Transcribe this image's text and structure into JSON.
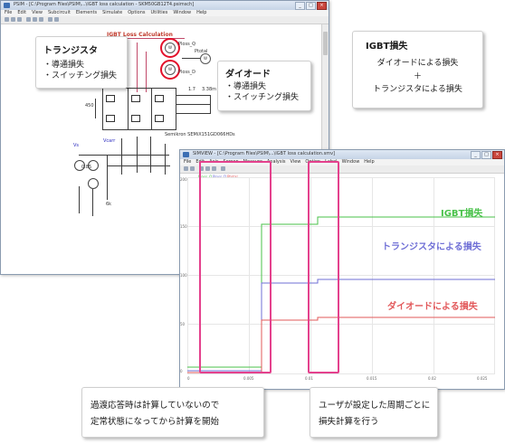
{
  "schematic_window": {
    "title": "PSIM - [C:\\Program Files\\PSIM\\...\\IGBT loss calculation - SKM50GB12T4.psimsch]",
    "menu": [
      "File",
      "Edit",
      "View",
      "Subcircuit",
      "Elements",
      "Simulate",
      "Options",
      "Utilities",
      "Window",
      "Help"
    ],
    "block_title": "IGBT Loss Calculation",
    "probe_labels": [
      "Ploss_Q",
      "Ptotal",
      "Ploss_D"
    ],
    "meter_labels": [
      "W",
      "W",
      "W"
    ],
    "component_values": [
      "1.7",
      "3.38m",
      "450",
      "0.85",
      "6k"
    ],
    "module_label": "Semikron SEMiX151GD066HDs",
    "source_labels": [
      "Vs",
      "Vcarr"
    ]
  },
  "callout_transistor": {
    "title": "トランジスタ",
    "items": [
      "・導通損失",
      "・スイッチング損失"
    ]
  },
  "callout_diode": {
    "title": "ダイオード",
    "items": [
      "・導通損失",
      "・スイッチング損失"
    ]
  },
  "igbt_summary": {
    "title": "IGBT損失",
    "line1": "ダイオードによる損失",
    "plus": "＋",
    "line2": "トランジスタによる損失"
  },
  "waveform_window": {
    "title": "SIMVIEW - [C:\\Program Files\\PSIM\\...\\IGBT loss calculation.smv]",
    "menu": [
      "File",
      "Edit",
      "Axis",
      "Screen",
      "Measure",
      "Analysis",
      "View",
      "Option",
      "Label",
      "Window",
      "Help"
    ],
    "legend_labels": [
      "Ploss_Q",
      "Ploss_D",
      "Ptotal"
    ],
    "series": [
      {
        "name": "IGBT損失",
        "color": "#49c24a"
      },
      {
        "name": "トランジスタによる損失",
        "color": "#6f6fd6"
      },
      {
        "name": "ダイオードによる損失",
        "color": "#e2585a"
      }
    ],
    "x_ticks": [
      "0",
      "0.005",
      "0.01",
      "0.015",
      "0.02",
      "0.025"
    ],
    "y_ticks": [
      "200",
      "150",
      "100",
      "50",
      "0"
    ]
  },
  "note_left": {
    "line1": "過渡応答時は計算していないので",
    "line2": "定常状態になってから計算を開始"
  },
  "note_right": {
    "line1": "ユーザが設定した周期ごとに",
    "line2": "損失計算を行う"
  },
  "colors": {
    "highlight": "#e4418d",
    "probe_ring": "#e3102a"
  }
}
